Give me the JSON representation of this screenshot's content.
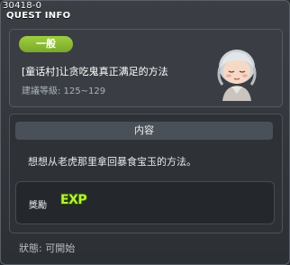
{
  "window": {
    "id_label": "30418-0",
    "title": "QUEST INFO"
  },
  "summary": {
    "category": "一般",
    "quest_name": "[童话村]让贪吃鬼真正满足的方法",
    "level_requirement": "建議等級: 125~129",
    "npc_icon": "elderly-npc-portrait-icon"
  },
  "details": {
    "section_header": "内容",
    "description": "想想从老虎那里拿回暴食宝玉的方法。",
    "reward_label": "獎勵",
    "reward_type": "EXP"
  },
  "status": {
    "text": "狀態: 可開始"
  },
  "colors": {
    "category_pill": "#8dbd34",
    "exp_text": "#b8f03a",
    "background": "#2b2f34"
  }
}
